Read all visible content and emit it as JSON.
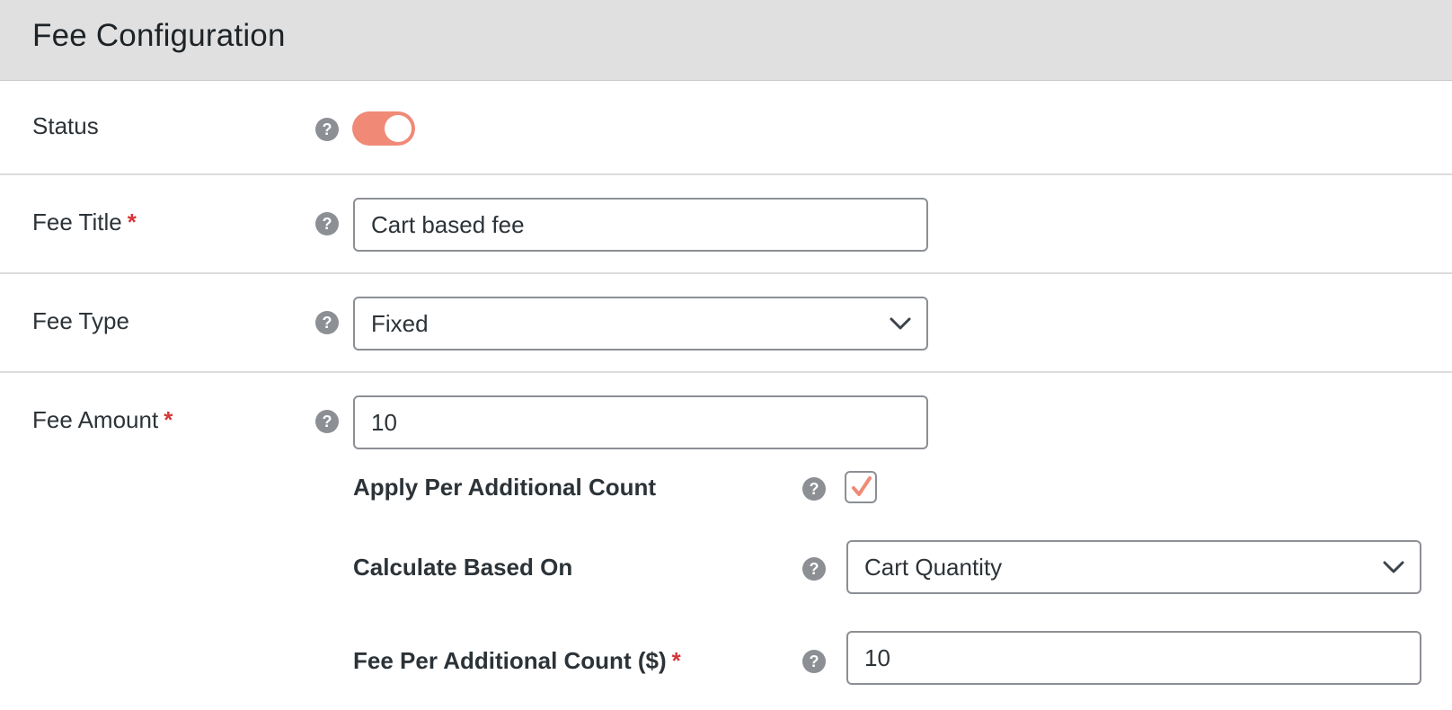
{
  "header": {
    "title": "Fee Configuration"
  },
  "status": {
    "label": "Status",
    "help_glyph": "?",
    "toggle_on": true,
    "accent": "#f08a77"
  },
  "fee_title": {
    "label": "Fee Title",
    "required_mark": "*",
    "help_glyph": "?",
    "value": "Cart based fee"
  },
  "fee_type": {
    "label": "Fee Type",
    "help_glyph": "?",
    "selected": "Fixed"
  },
  "fee_amount": {
    "label": "Fee Amount",
    "required_mark": "*",
    "help_glyph": "?",
    "value": "10",
    "apply_per_additional": {
      "label": "Apply Per Additional Count",
      "help_glyph": "?",
      "checked": true
    },
    "calculate_based_on": {
      "label": "Calculate Based On",
      "help_glyph": "?",
      "selected": "Cart Quantity"
    },
    "fee_per_additional": {
      "label": "Fee Per Additional Count ($)",
      "required_mark": "*",
      "help_glyph": "?",
      "value": "10"
    }
  },
  "icons": {
    "help": "question-circle-icon",
    "dropdown": "chevron-down-icon",
    "check": "checkmark-icon"
  },
  "colors": {
    "required": "#d63638",
    "help_icon": "#8c8f94",
    "header_bg": "#e0e0e0"
  }
}
